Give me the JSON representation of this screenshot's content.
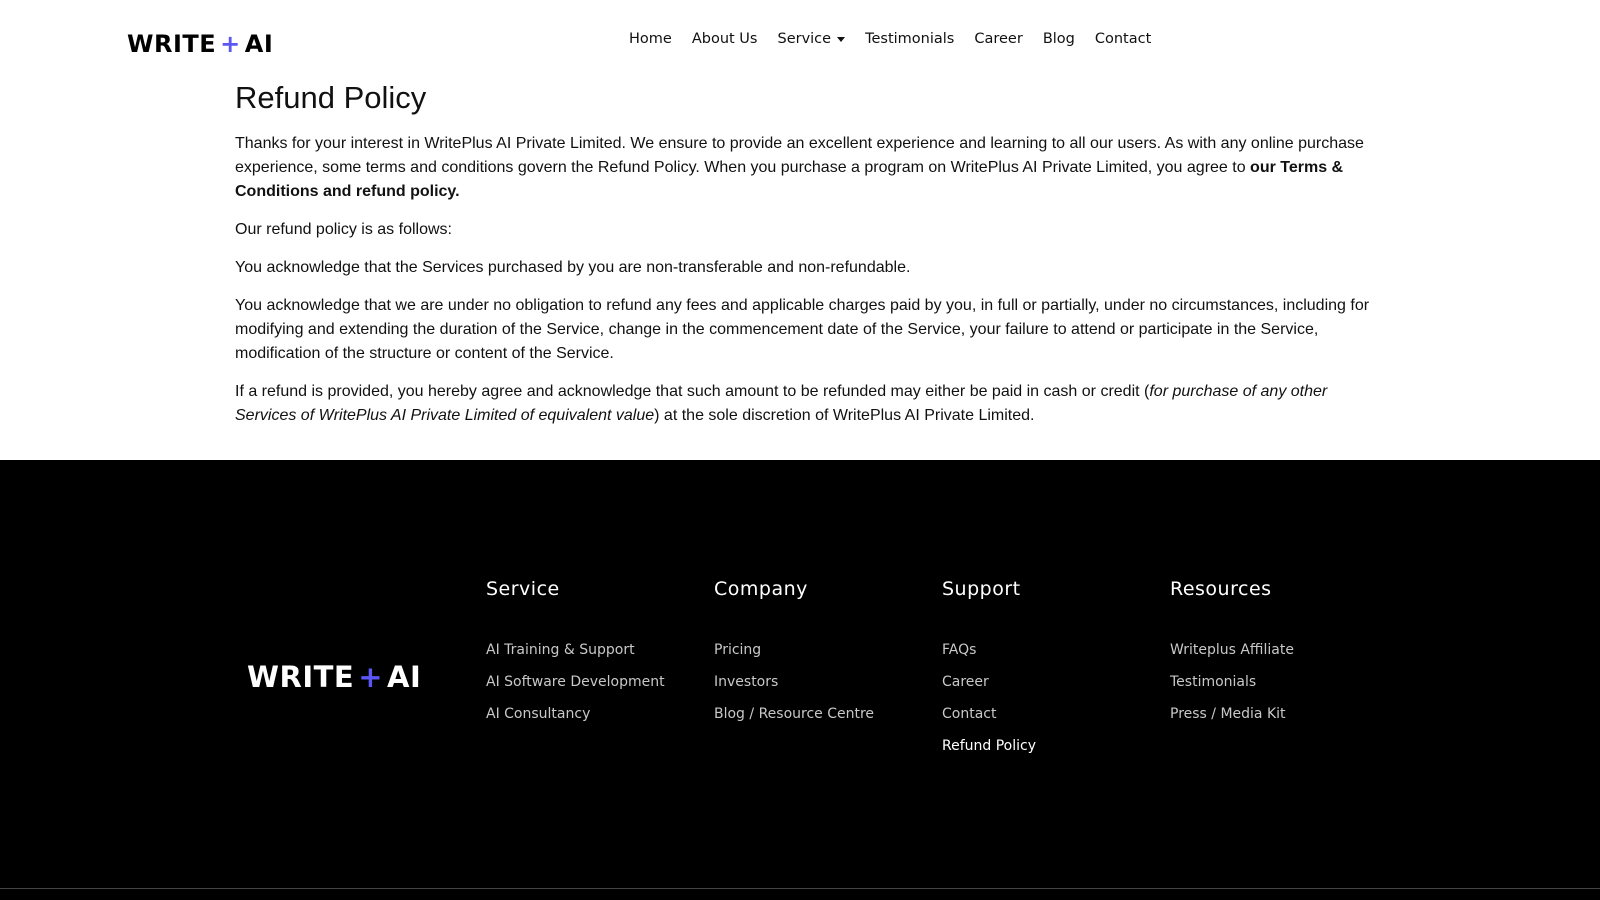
{
  "header": {
    "logo": {
      "left": "WRITE",
      "plus": "+",
      "right": "AI"
    },
    "nav": [
      {
        "label": "Home"
      },
      {
        "label": "About Us"
      },
      {
        "label": "Service",
        "dropdown": true
      },
      {
        "label": "Testimonials"
      },
      {
        "label": "Career"
      },
      {
        "label": "Blog"
      },
      {
        "label": "Contact"
      }
    ]
  },
  "main": {
    "title": "Refund Policy",
    "p1_a": "Thanks for your interest in WritePlus AI Private Limited. We ensure to provide an excellent experience and learning to all our users. As with any online purchase experience, some terms and conditions govern the Refund Policy. When you purchase a program on WritePlus AI Private Limited, you agree to ",
    "p1_bold": "our Terms & Conditions and refund policy.",
    "p2": "Our refund policy is as follows:",
    "p3": "You acknowledge that the Services purchased by you are non-transferable and non-refundable.",
    "p4": "You acknowledge that we are under no obligation to refund any fees and applicable charges paid by you, in full or partially, under no circumstances, including for modifying and extending the duration of the Service, change in the commencement date of the Service, your failure to attend or participate in the Service, modification of the structure or content of the Service.",
    "p5_a": "If a refund is provided, you hereby agree and acknowledge that such amount to be refunded may either be paid in cash or credit (",
    "p5_italic": "for purchase of any other Services of WritePlus AI Private Limited of equivalent value",
    "p5_b": ") at the sole discretion of WritePlus AI Private Limited."
  },
  "footer": {
    "logo": {
      "left": "WRITE",
      "plus": "+",
      "right": "AI"
    },
    "columns": [
      {
        "title": "Service",
        "links": [
          "AI Training & Support",
          "AI Software Development",
          "AI Consultancy"
        ]
      },
      {
        "title": "Company",
        "links": [
          "Pricing",
          "Investors",
          "Blog / Resource Centre"
        ]
      },
      {
        "title": "Support",
        "links": [
          "FAQs",
          "Career",
          "Contact",
          "Refund Policy"
        ],
        "active": "Refund Policy"
      },
      {
        "title": "Resources",
        "links": [
          "Writeplus Affiliate",
          "Testimonials",
          "Press / Media Kit"
        ]
      }
    ]
  },
  "colors": {
    "accent": "#5b57f5",
    "footer_bg": "#000000"
  }
}
